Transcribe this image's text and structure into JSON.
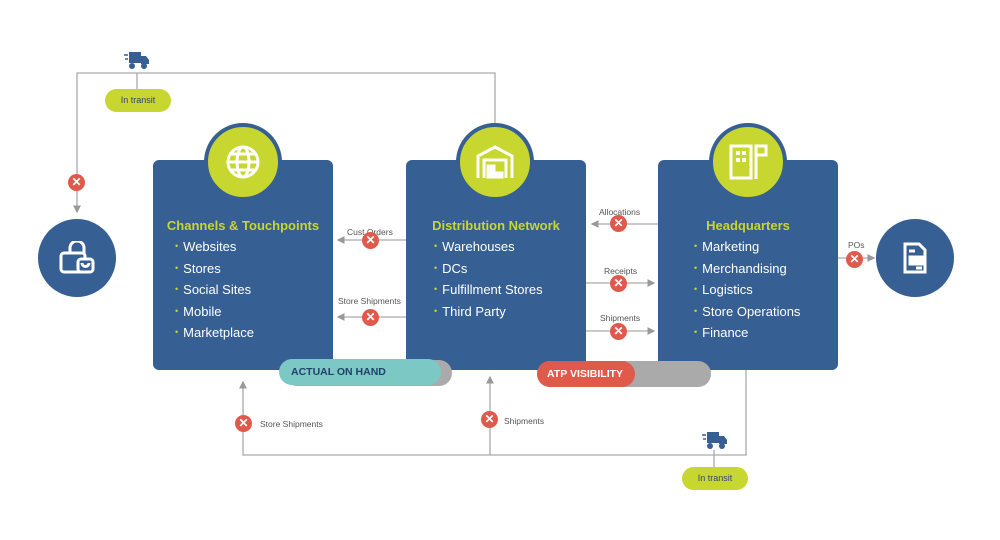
{
  "colors": {
    "box": "#365f93",
    "accent": "#c8d630",
    "error": "#e05a4c",
    "teal": "#7cc8c4",
    "gray": "#aaaaaa"
  },
  "boxes": [
    {
      "title": "Channels & Touchpoints",
      "icon": "globe-icon",
      "items": [
        "Websites",
        "Stores",
        "Social Sites",
        "Mobile",
        "Marketplace"
      ]
    },
    {
      "title": "Distribution Network",
      "icon": "warehouse-icon",
      "items": [
        "Warehouses",
        "DCs",
        "Fulfillment Stores",
        "Third Party"
      ]
    },
    {
      "title": "Headquarters",
      "icon": "office-building-icon",
      "items": [
        "Marketing",
        "Merchandising",
        "Logistics",
        "Store Operations",
        "Finance"
      ]
    }
  ],
  "endpoints": {
    "left": "shopping-bag-icon",
    "right": "document-icon"
  },
  "flows": {
    "cust_orders": "Cust Orders",
    "store_shipments": "Store Shipments",
    "allocations": "Allocations",
    "receipts": "Receipts",
    "shipments": "Shipments",
    "pos": "POs",
    "bottom_store_shipments": "Store Shipments",
    "bottom_shipments": "Shipments"
  },
  "transit": {
    "top": "In transit",
    "bottom": "In transit"
  },
  "bars": {
    "actual": "ACTUAL ON HAND",
    "atp": "ATP VISIBILITY"
  }
}
